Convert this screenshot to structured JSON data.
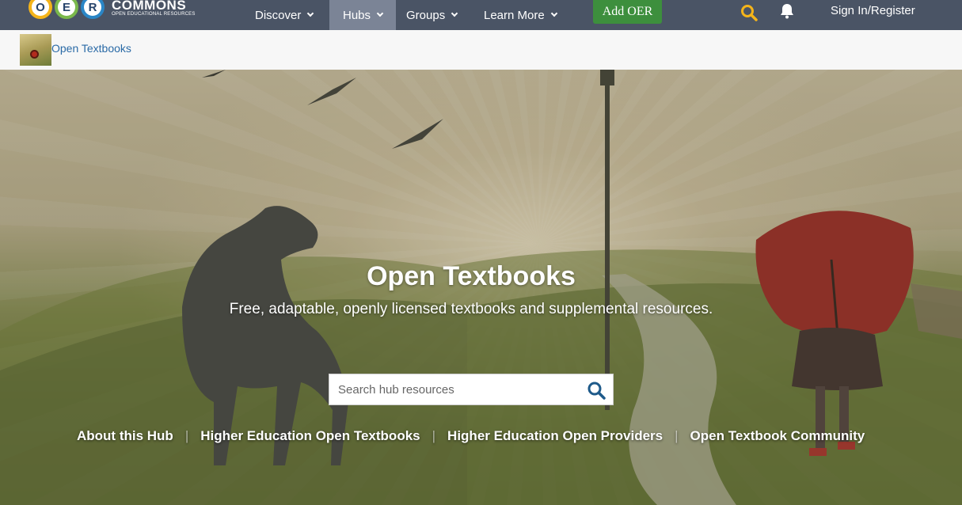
{
  "logo": {
    "letters": [
      "O",
      "E",
      "R"
    ],
    "wordmark": "COMMONS",
    "tagline": "OPEN EDUCATIONAL RESOURCES"
  },
  "nav": {
    "items": [
      {
        "label": "Discover"
      },
      {
        "label": "Hubs"
      },
      {
        "label": "Groups"
      },
      {
        "label": "Learn More"
      }
    ],
    "add_button": "Add OER",
    "sign_in": "Sign In/Register",
    "active_item": "Hubs"
  },
  "breadcrumb": {
    "hub_name": "Open Textbooks"
  },
  "hero": {
    "title": "Open Textbooks",
    "subtitle": "Free, adaptable, openly licensed textbooks and supplemental resources.",
    "search_placeholder": "Search hub resources",
    "links": [
      {
        "label": "About this Hub"
      },
      {
        "label": "Higher Education Open Textbooks"
      },
      {
        "label": "Higher Education Open Providers"
      },
      {
        "label": "Open Textbook Community"
      }
    ]
  },
  "colors": {
    "nav_bg": "#4a5465",
    "nav_active": "#7b8496",
    "add_button": "#3d8f3d",
    "search_icon_top": "#f4b41a",
    "link": "#2a6aa6"
  },
  "icons": {
    "search_top": "search-icon",
    "bell": "bell-icon",
    "hero_search": "search-icon",
    "chevron": "chevron-down-icon"
  }
}
